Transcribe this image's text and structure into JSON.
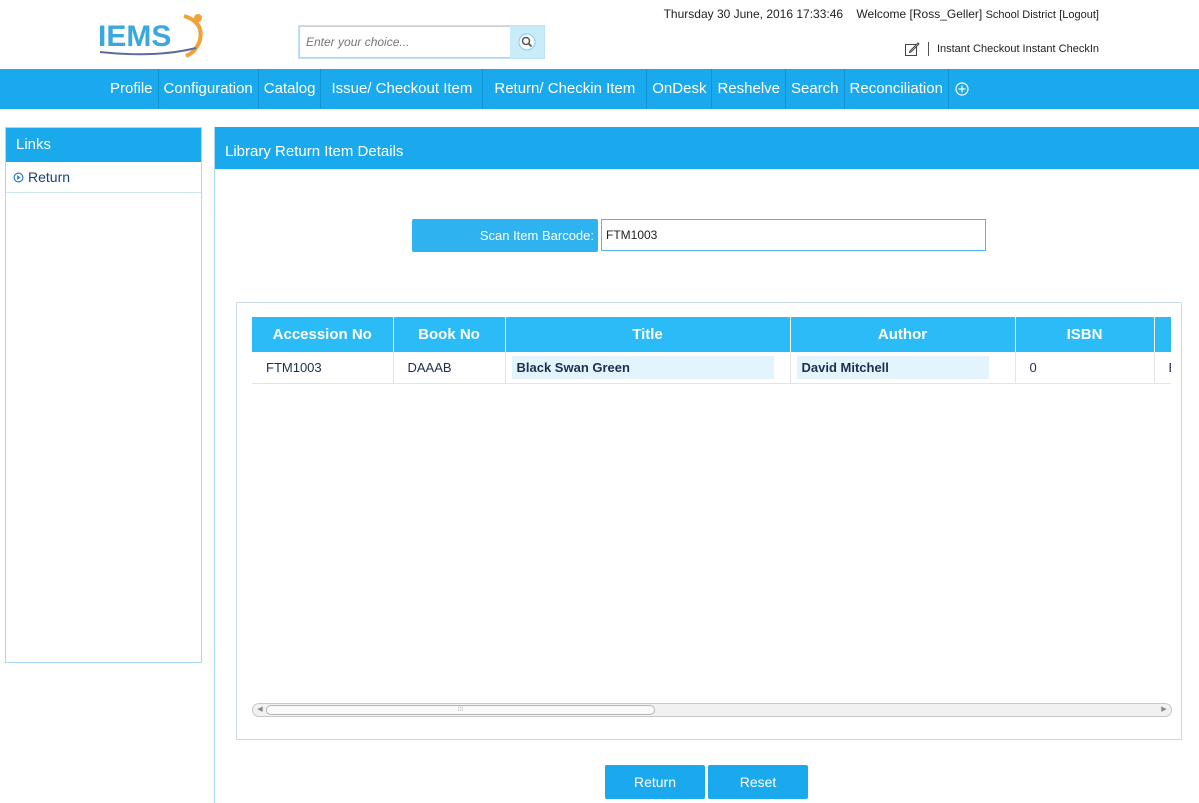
{
  "header": {
    "datetime": "Thursday 30 June, 2016 17:33:46",
    "welcome_prefix": "Welcome [",
    "user": "Ross_Geller",
    "welcome_suffix": "]",
    "district": "School District",
    "logout": "[Logout]",
    "search_placeholder": "Enter your choice...",
    "quick_links": "Instant Checkout Instant CheckIn",
    "logo_text": "IEMS"
  },
  "nav": {
    "items": [
      "Profile",
      "Configuration",
      "Catalog",
      "Issue/ Checkout Item",
      "Return/ Checkin Item",
      "OnDesk",
      "Reshelve",
      "Search",
      "Reconciliation"
    ]
  },
  "sidebar": {
    "title": "Links",
    "items": [
      {
        "label": "Return"
      }
    ]
  },
  "main": {
    "title": "Library Return Item Details",
    "barcode_label": "Scan Item Barcode:",
    "barcode_value": "FTM1003",
    "table": {
      "columns": [
        "Accession No",
        "Book No",
        "Title",
        "Author",
        "ISBN"
      ],
      "rows": [
        {
          "accession": "FTM1003",
          "book_no": "DAAAB",
          "title": "Black Swan Green",
          "author": "David Mitchell",
          "isbn": "0",
          "extra": "E"
        }
      ]
    },
    "buttons": {
      "return": "Return",
      "reset": "Reset"
    }
  },
  "colors": {
    "accent": "#1aa9ec",
    "header_cell": "#2bbbf7"
  }
}
